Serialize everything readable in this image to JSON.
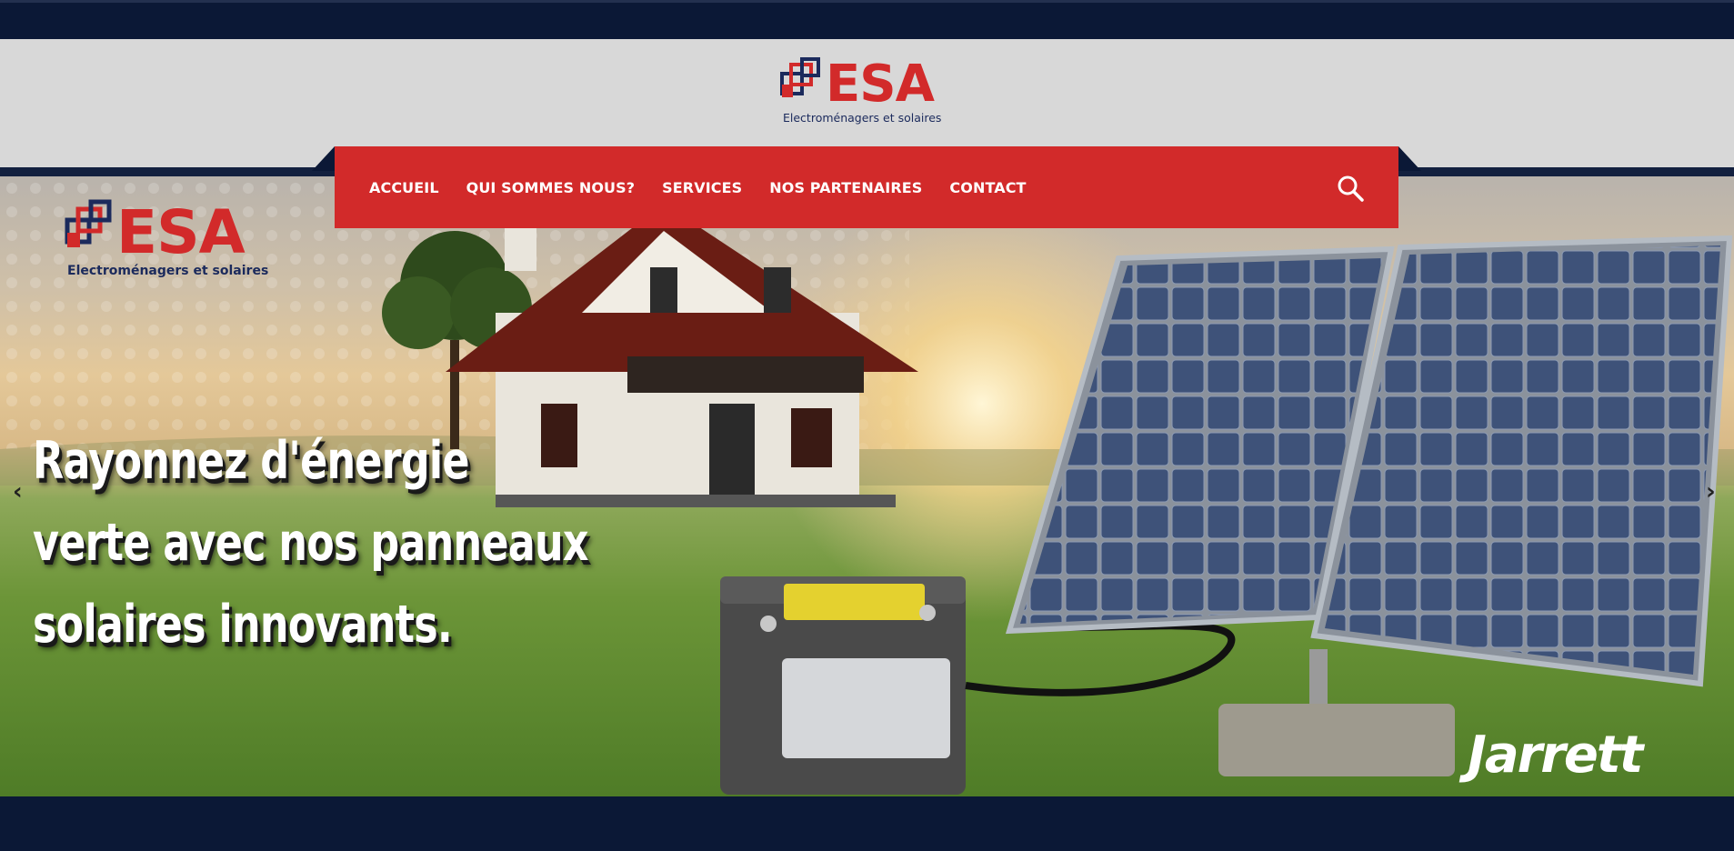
{
  "header": {
    "logo": {
      "wordmark": "ESA",
      "tagline": "Electroménagers et solaires"
    }
  },
  "nav": {
    "items": [
      "ACCUEIL",
      "QUI SOMMES NOUS?",
      "SERVICES",
      "NOS PARTENAIRES",
      "CONTACT"
    ],
    "search_icon": "search-icon"
  },
  "hero": {
    "logo": {
      "wordmark": "ESA",
      "tagline": "Electroménagers et solaires"
    },
    "headline": [
      "Rayonnez d'énergie",
      "verte avec nos panneaux",
      "solaires innovants."
    ],
    "prev_arrow": "‹",
    "next_arrow": "›",
    "brand": "Jarrett"
  },
  "colors": {
    "navy": "#0b1836",
    "accent_red": "#d22a2a",
    "header_gray": "#d8d8d8",
    "logo_blue": "#1b2a5c"
  }
}
